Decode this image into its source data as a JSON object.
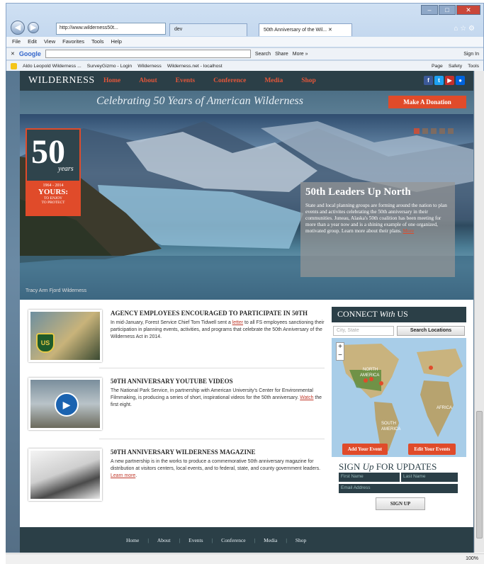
{
  "browser": {
    "address": "http://www.wilderness50t...",
    "tabs": [
      "dev",
      "50th Anniversary of the Wil..."
    ],
    "menu": [
      "File",
      "Edit",
      "View",
      "Favorites",
      "Tools",
      "Help"
    ],
    "toolbar": {
      "google": "Google",
      "search": "Search",
      "share": "Share",
      "more": "More »",
      "signin": "Sign In"
    },
    "favorites": [
      "Aldo Leopold Wilderness ...",
      "SurveyGizmo - Login",
      "Wilderness",
      "Wilderness.net - localhost"
    ],
    "cmd": [
      "Page",
      "Safety",
      "Tools"
    ],
    "zoom": "100%"
  },
  "site": {
    "brand": "WILDERNESS",
    "nav": [
      "Home",
      "About",
      "Events",
      "Conference",
      "Media",
      "Shop"
    ],
    "tagline": "Celebrating 50 Years of American Wilderness",
    "donate": "Make A Donation",
    "logo": {
      "number": "50",
      "years": "years",
      "dates": "1964 - 2014",
      "yours": "YOURS:",
      "sub1": "TO ENJOY",
      "sub2": "TO PROTECT"
    },
    "slide": {
      "title": "50th Leaders Up North",
      "body": "State and local planning groups are forming around the nation to plan events and activites celebrating the 50th anniversary in their communities. Juneau, Alaska's 50th coalition has been meeting for more than a year now and is a shining example of one organized, motivated group. Learn more about their plans.",
      "more": "More"
    },
    "caption": "Tracy Arm Fjord Wilderness",
    "articles": [
      {
        "title": "AGENCY EMPLOYEES ENCOURAGED TO PARTICIPATE IN 50TH",
        "pre": "In mid-January, Forest Service Chief Tom Tidwell sent a ",
        "link": "letter",
        "post": " to all FS employees sanctioning their participation in planning events, activities, and programs that celebrate the 50th Anniversary of the Wilderness Act in 2014."
      },
      {
        "title": "50TH ANNIVERSARY YOUTUBE VIDEOS",
        "pre": "The National Park Service, in partnership with American University's Center for Environmental Filmmaking, is producing a series of short, inspirational videos for the 50th anniversary. ",
        "link": "Watch",
        "post": " the first eight."
      },
      {
        "title": "50TH ANNIVERSARY WILDERNESS MAGAZINE",
        "pre": "A new partnership is in the works to produce a commemorative 50th anniversary magazine for distribution at visitors centers, local events, and to federal, state, and county government leaders. ",
        "link": "Learn more",
        "post": "."
      }
    ],
    "connect": {
      "title_a": "CONNECT ",
      "title_b": "With",
      "title_c": " US",
      "placeholder": "City, State",
      "search": "Search Locations",
      "add": "Add Your Event",
      "edit": "Edit Your Events",
      "map_labels": [
        "NORTH",
        "AMERICA",
        "SOUTH",
        "AMERICA",
        "AFRICA"
      ]
    },
    "signup": {
      "a": "SIGN ",
      "b": "Up",
      "c": " FOR UPDATES",
      "first": "First Name",
      "last": "Last Name",
      "email": "Email Address",
      "btn": "SIGN UP"
    },
    "footer": [
      "Home",
      "About",
      "Events",
      "Conference",
      "Media",
      "Shop"
    ]
  }
}
